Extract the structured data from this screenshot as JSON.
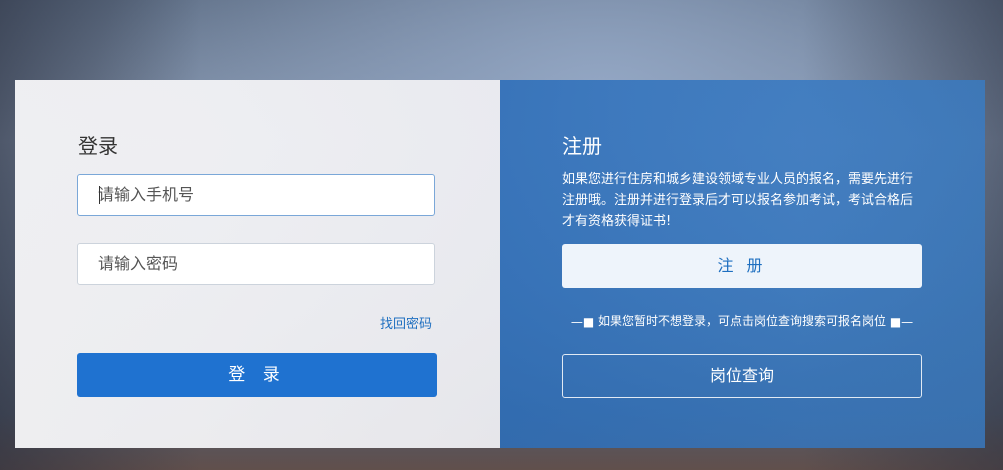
{
  "login": {
    "title": "登录",
    "phone_placeholder": "请输入手机号",
    "password_placeholder": "请输入密码",
    "forgot_label": "找回密码",
    "submit_label": "登 录"
  },
  "register": {
    "title": "注册",
    "description": "如果您进行住房和城乡建设领域专业人员的报名，需要先进行注册哦。注册并进行登录后才可以报名参加考试，考试合格后才有资格获得证书!",
    "button_label": "注 册",
    "tip_left": "—■",
    "tip_text": "如果您暂时不想登录，可点击岗位查询搜索可报名岗位",
    "tip_right": "■—",
    "query_label": "岗位查询"
  },
  "colors": {
    "primary": "#1f72d0",
    "right_panel": "#2d6eb9",
    "link": "#1e6fc0"
  }
}
